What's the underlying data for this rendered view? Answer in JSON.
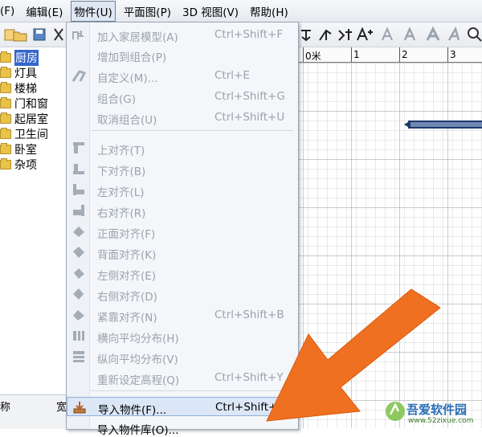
{
  "menubar": {
    "items": [
      {
        "label": "(F)"
      },
      {
        "label": "编辑(E)"
      },
      {
        "label": "物件(U)"
      },
      {
        "label": "平面图(P)"
      },
      {
        "label": "3D 视图(V)"
      },
      {
        "label": "帮助(H)"
      }
    ]
  },
  "tree": {
    "items": [
      {
        "label": "厨房",
        "selected": true
      },
      {
        "label": "灯具"
      },
      {
        "label": "楼梯"
      },
      {
        "label": "门和窗"
      },
      {
        "label": "起居室"
      },
      {
        "label": "卫生间"
      },
      {
        "label": "卧室"
      },
      {
        "label": "杂项"
      }
    ]
  },
  "bottom_panel": {
    "col1": "称",
    "col2": "宽"
  },
  "ruler": {
    "labels": [
      "0米",
      "1",
      "2",
      "3"
    ]
  },
  "dropdown": {
    "items": [
      {
        "label": "加入家居模型(A)",
        "shortcut": "Ctrl+Shift+F",
        "icon": "add-furniture-icon"
      },
      {
        "label": "增加到组合(P)",
        "shortcut": "",
        "icon": ""
      },
      {
        "label": "自定义(M)...",
        "shortcut": "Ctrl+E",
        "icon": "modify-icon"
      },
      {
        "label": "组合(G)",
        "shortcut": "Ctrl+Shift+G",
        "icon": ""
      },
      {
        "label": "取消组合(U)",
        "shortcut": "Ctrl+Shift+U",
        "icon": ""
      },
      {
        "label": "上对齐(T)",
        "shortcut": "",
        "icon": "align-top-icon"
      },
      {
        "label": "下对齐(B)",
        "shortcut": "",
        "icon": "align-bottom-icon"
      },
      {
        "label": "左对齐(L)",
        "shortcut": "",
        "icon": "align-left-icon"
      },
      {
        "label": "右对齐(R)",
        "shortcut": "",
        "icon": "align-right-icon"
      },
      {
        "label": "正面对齐(F)",
        "shortcut": "",
        "icon": "align-front-icon"
      },
      {
        "label": "背面对齐(K)",
        "shortcut": "",
        "icon": "align-back-icon"
      },
      {
        "label": "左侧对齐(E)",
        "shortcut": "",
        "icon": "align-left-side-icon"
      },
      {
        "label": "右侧对齐(D)",
        "shortcut": "",
        "icon": "align-right-side-icon"
      },
      {
        "label": "紧靠对齐(N)",
        "shortcut": "Ctrl+Shift+B",
        "icon": "align-side-by-side-icon"
      },
      {
        "label": "横向平均分布(H)",
        "shortcut": "",
        "icon": "distribute-horizontal-icon"
      },
      {
        "label": "纵向平均分布(V)",
        "shortcut": "",
        "icon": "distribute-vertical-icon"
      },
      {
        "label": "重新设定高程(Q)",
        "shortcut": "Ctrl+Shift+Y",
        "icon": ""
      },
      {
        "label": "导入物件(F)...",
        "shortcut": "Ctrl+Shift+I",
        "icon": "import-furniture-icon"
      },
      {
        "label": "导入物件库(O)...",
        "shortcut": "",
        "icon": ""
      }
    ]
  },
  "watermark": {
    "text": "吾爱软件园",
    "url": "www.52zixue.com"
  },
  "colors": {
    "accent_orange": "#f07021",
    "selection_blue": "#3366cc",
    "wall_blue": "#1e3a6a"
  }
}
